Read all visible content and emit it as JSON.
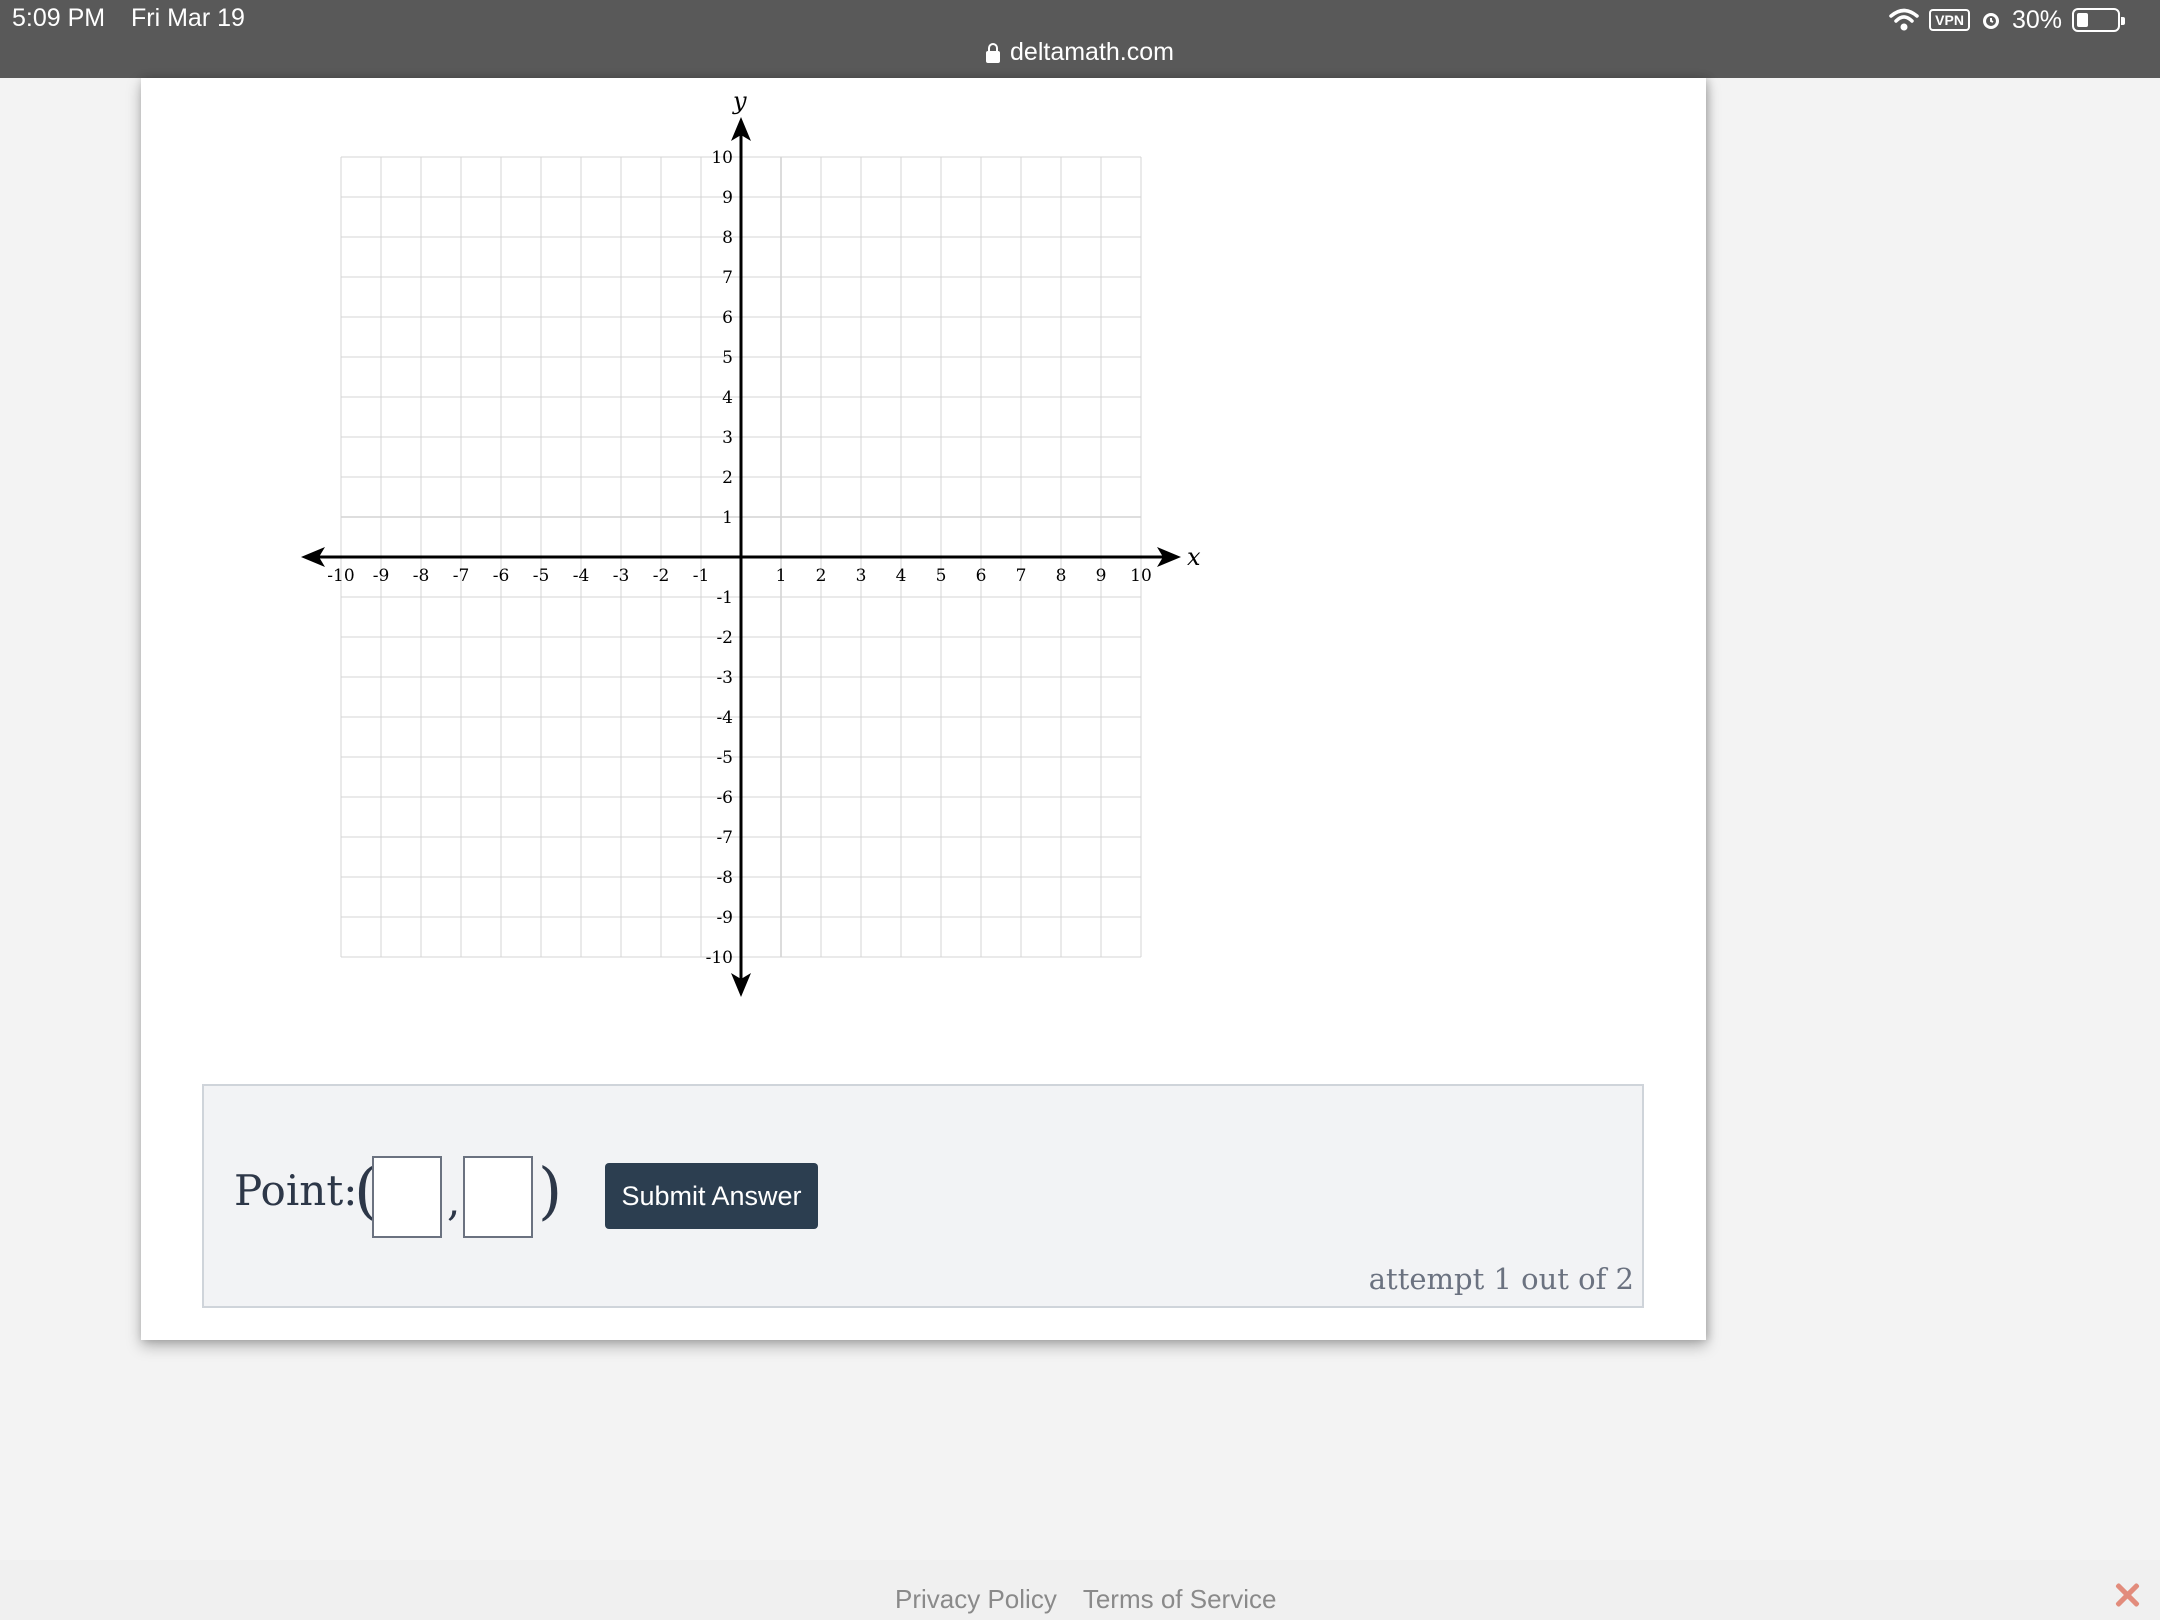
{
  "status_bar": {
    "time": "5:09 PM",
    "date": "Fri Mar 19",
    "vpn": "VPN",
    "battery": "30%",
    "battery_level": 0.3,
    "icons": [
      "wifi-icon",
      "vpn-icon",
      "alarm-icon",
      "battery-icon"
    ]
  },
  "browser": {
    "url": "deltamath.com"
  },
  "graph": {
    "x_axis_label": "x",
    "y_axis_label": "y"
  },
  "chart_data": {
    "type": "scatter",
    "xlim": [
      -10,
      10
    ],
    "ylim": [
      -10,
      10
    ],
    "xlabel": "x",
    "ylabel": "y",
    "grid": true,
    "x_ticks": [
      "-10",
      "-9",
      "-8",
      "-7",
      "-6",
      "-5",
      "-4",
      "-3",
      "-2",
      "-1",
      "1",
      "2",
      "3",
      "4",
      "5",
      "6",
      "7",
      "8",
      "9",
      "10"
    ],
    "y_ticks": [
      "10",
      "9",
      "8",
      "7",
      "6",
      "5",
      "4",
      "3",
      "2",
      "1",
      "-1",
      "-2",
      "-3",
      "-4",
      "-5",
      "-6",
      "-7",
      "-8",
      "-9",
      "-10"
    ],
    "points": []
  },
  "answer": {
    "point_label": "Point:",
    "open_paren": "(",
    "comma": ",",
    "close_paren": ")",
    "x_value": "",
    "y_value": "",
    "submit_label": "Submit Answer",
    "attempt_text": "attempt 1 out of 2"
  },
  "footer": {
    "privacy": "Privacy Policy",
    "terms": "Terms of Service"
  },
  "colors": {
    "status_bar": "#595959",
    "submit_button": "#2c3e50",
    "panel_bg": "#f2f3f5",
    "close_icon": "#e28c7c"
  }
}
